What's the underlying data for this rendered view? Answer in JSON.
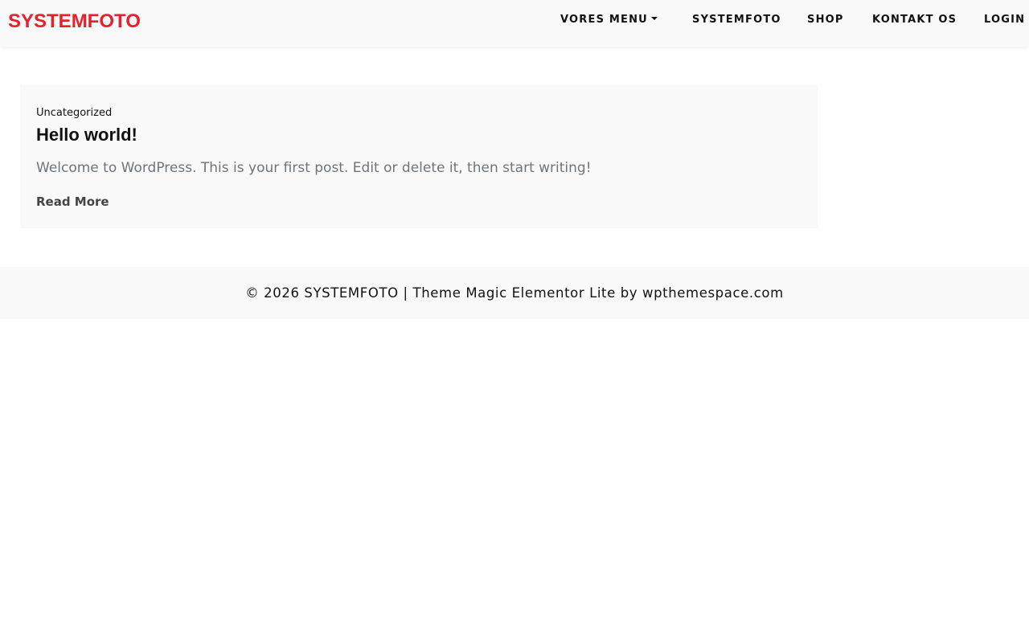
{
  "header": {
    "brand": "SYSTEMFOTO",
    "nav": {
      "menu": "VORES MENU",
      "systemfoto": "SYSTEMFOTO",
      "shop": "SHOP",
      "contact": "KONTAKT OS",
      "login": "LOGIN"
    },
    "dropdown_icon": "caret-down-icon"
  },
  "post": {
    "category": "Uncategorized",
    "title": "Hello world!",
    "excerpt": "Welcome to WordPress. This is your first post. Edit or delete it, then start writing!",
    "read_more": "Read More"
  },
  "footer": {
    "text": "© 2026 SYSTEMFOTO | Theme Magic Elementor Lite by wpthemespace.com"
  },
  "colors": {
    "brand": "#e4212d",
    "header_bg": "#f9f9f9",
    "card_bg": "#f9f9f9",
    "excerpt_text": "#6c757d"
  }
}
